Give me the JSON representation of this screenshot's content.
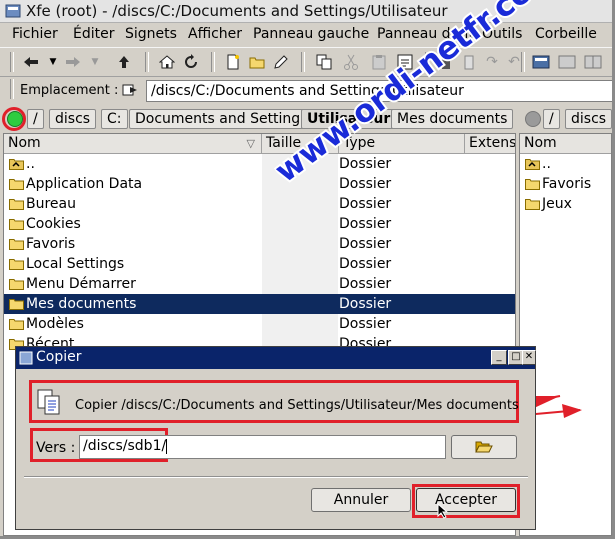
{
  "window": {
    "title": "Xfe (root) - /discs/C:/Documents and Settings/Utilisateur"
  },
  "menu": [
    "Fichier",
    "Éditer",
    "Signets",
    "Afficher",
    "Panneau gauche",
    "Panneau droit",
    "Outils",
    "Corbeille"
  ],
  "location": {
    "label": "Emplacement :",
    "value": "/discs/C:/Documents and Settings/Utilisateur"
  },
  "path_left": [
    "/",
    "discs",
    "C:",
    "Documents and Settings",
    "Utilisateur",
    "Mes documents"
  ],
  "path_right": [
    "/",
    "discs"
  ],
  "left_panel": {
    "columns": [
      "Nom",
      "Taille",
      "Type",
      "Extens"
    ],
    "rows": [
      {
        "name": "..",
        "type": "Dossier"
      },
      {
        "name": "Application Data",
        "type": "Dossier"
      },
      {
        "name": "Bureau",
        "type": "Dossier"
      },
      {
        "name": "Cookies",
        "type": "Dossier"
      },
      {
        "name": "Favoris",
        "type": "Dossier"
      },
      {
        "name": "Local Settings",
        "type": "Dossier"
      },
      {
        "name": "Menu Démarrer",
        "type": "Dossier"
      },
      {
        "name": "Mes documents",
        "type": "Dossier",
        "selected": true
      },
      {
        "name": "Modèles",
        "type": "Dossier"
      },
      {
        "name": "Récent",
        "type": "Dossier"
      }
    ]
  },
  "right_panel": {
    "columns": [
      "Nom"
    ],
    "rows": [
      {
        "name": ".."
      },
      {
        "name": "Favoris"
      },
      {
        "name": "Jeux"
      }
    ]
  },
  "dialog": {
    "title": "Copier",
    "message": "Copier /discs/C:/Documents and Settings/Utilisateur/Mes documents",
    "to_label": "Vers :",
    "to_value": "/discs/sdb1/",
    "cancel_label": "Annuler",
    "accept_label": "Accepter"
  },
  "watermark": "www.ordi-netfr.com",
  "colors": {
    "selection": "#0e2a5e",
    "dialog_title": "#0a246a",
    "annotation": "#e0202a",
    "watermark": "#1a2bd8",
    "led": "#2ecc40"
  }
}
